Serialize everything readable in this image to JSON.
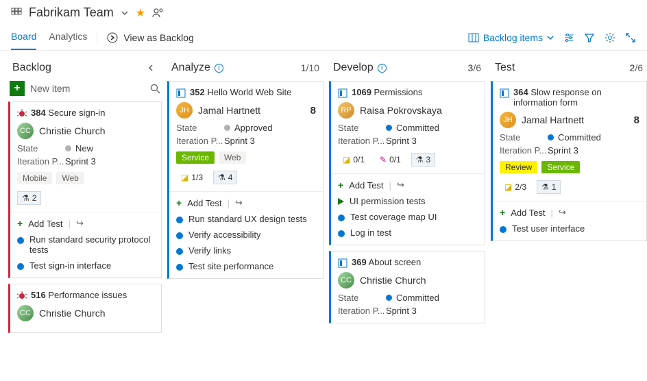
{
  "header": {
    "team_name": "Fabrikam Team"
  },
  "tabs": {
    "board": "Board",
    "analytics": "Analytics",
    "view_as_backlog": "View as Backlog",
    "backlog_items": "Backlog items"
  },
  "columns": {
    "backlog": {
      "title": "Backlog",
      "new_item": "New item"
    },
    "analyze": {
      "title": "Analyze",
      "count": "1",
      "of": "/10"
    },
    "develop": {
      "title": "Develop",
      "count": "3",
      "of": "/6"
    },
    "test": {
      "title": "Test",
      "count": "2",
      "of": "/6"
    }
  },
  "labels": {
    "state": "State",
    "iteration": "Iteration P...",
    "add_test": "Add Test"
  },
  "cards": {
    "c384": {
      "id": "384",
      "title": "Secure sign-in",
      "assignee": "Christie Church",
      "state": "New",
      "iteration": "Sprint 3",
      "tags": [
        "Mobile",
        "Web"
      ],
      "flask": "2",
      "tests": [
        "Run standard security protocol tests",
        "Test sign-in interface"
      ]
    },
    "c516": {
      "id": "516",
      "title": "Performance issues",
      "assignee": "Christie Church"
    },
    "c352": {
      "id": "352",
      "title": "Hello World Web Site",
      "assignee": "Jamal Hartnett",
      "effort": "8",
      "state": "Approved",
      "iteration": "Sprint 3",
      "tag_green": "Service",
      "tag_plain": "Web",
      "clip": "1/3",
      "flask": "4",
      "tests": [
        "Run standard UX design tests",
        "Verify accessibility",
        "Verify links",
        "Test site performance"
      ]
    },
    "c1069": {
      "id": "1069",
      "title": "Permissions",
      "assignee": "Raisa Pokrovskaya",
      "state": "Committed",
      "iteration": "Sprint 3",
      "clip": "0/1",
      "pencil": "0/1",
      "flask": "3",
      "tests": [
        "UI permission tests",
        "Test coverage map UI",
        "Log in test"
      ]
    },
    "c369": {
      "id": "369",
      "title": "About screen",
      "assignee": "Christie Church",
      "state": "Committed",
      "iteration": "Sprint 3"
    },
    "c364": {
      "id": "364",
      "title": "Slow response on information form",
      "assignee": "Jamal Hartnett",
      "effort": "8",
      "state": "Committed",
      "iteration": "Sprint 3",
      "tag_yellow": "Review",
      "tag_green": "Service",
      "clip": "2/3",
      "flask": "1",
      "tests": [
        "Test user interface"
      ]
    }
  }
}
